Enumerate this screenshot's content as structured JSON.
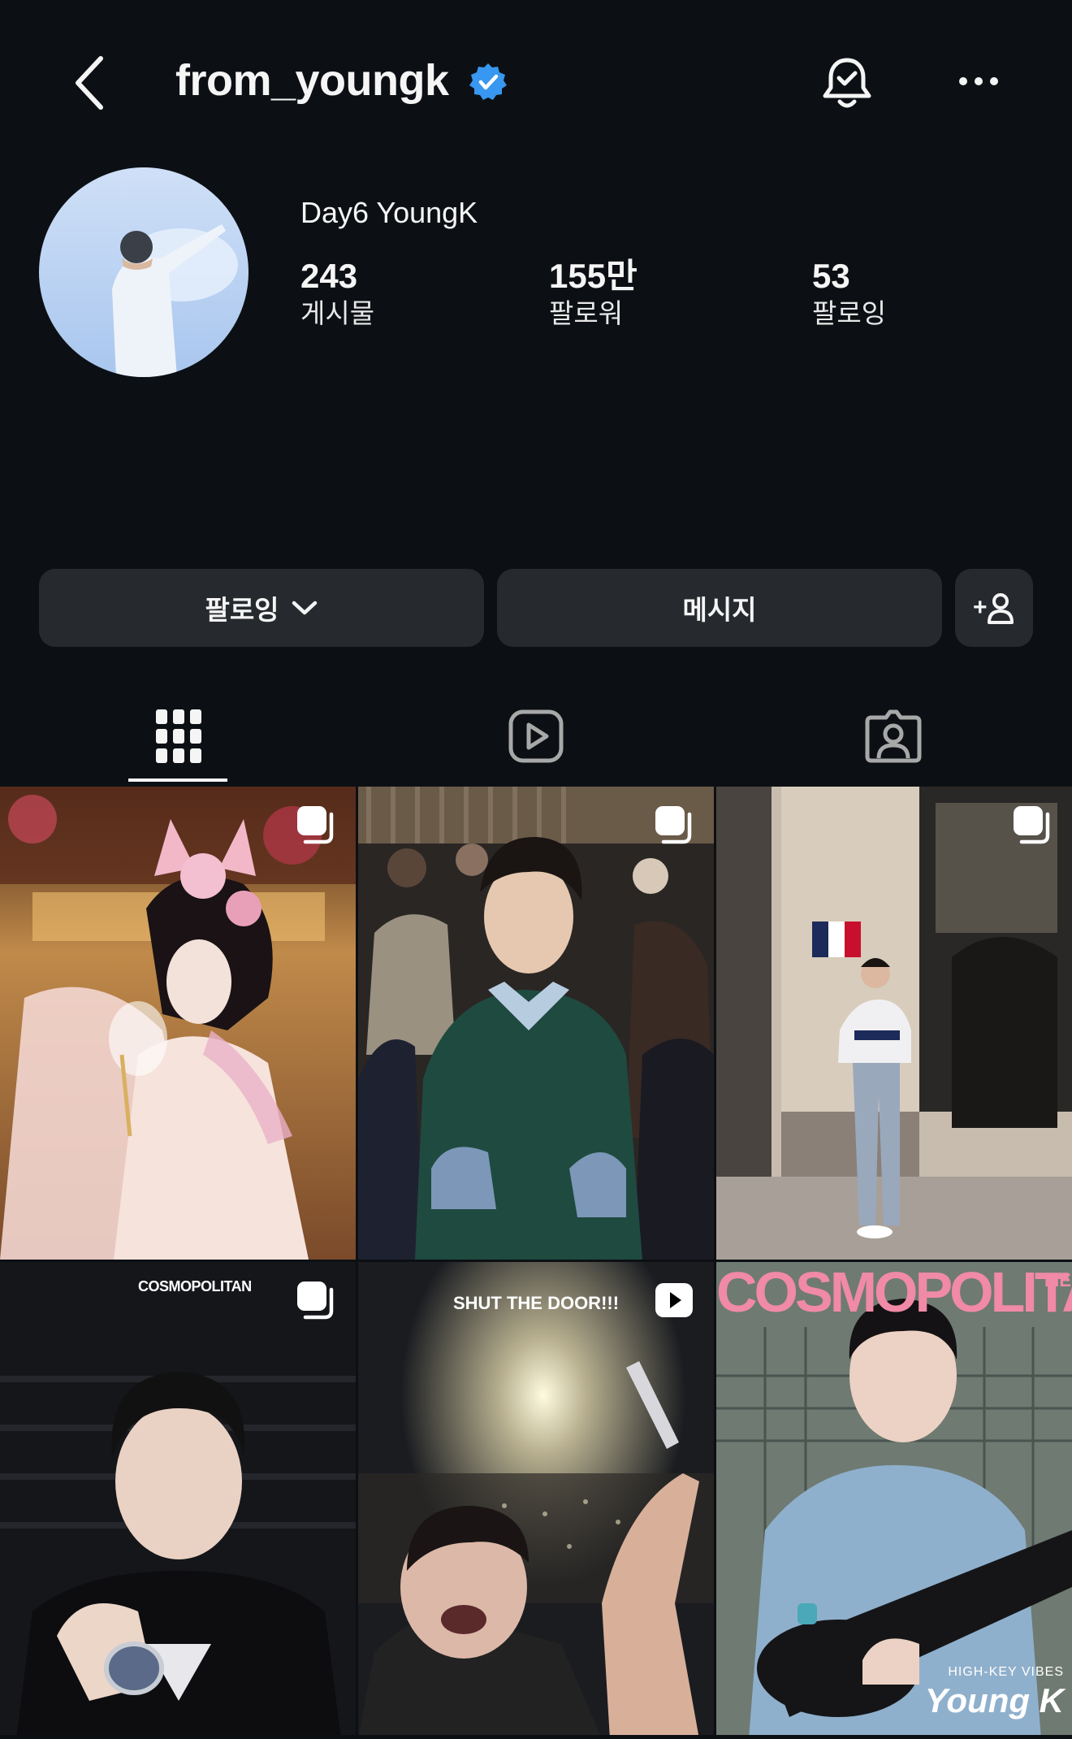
{
  "header": {
    "username": "from_youngk",
    "back_icon": "chevron-left-icon",
    "verified_icon": "verified-badge-icon",
    "bell_icon": "bell-check-icon",
    "more_icon": "more-horizontal-icon"
  },
  "profile": {
    "display_name": "Day6 YoungK",
    "stats": [
      {
        "number": "243",
        "label": "게시물"
      },
      {
        "number": "155만",
        "label": "팔로워"
      },
      {
        "number": "53",
        "label": "팔로잉"
      }
    ]
  },
  "actions": {
    "following_label": "팔로잉",
    "message_label": "메시지",
    "add_icon": "add-person-icon",
    "add_label": "+"
  },
  "tabs": [
    {
      "name": "grid",
      "icon": "grid-icon",
      "active": true
    },
    {
      "name": "reels",
      "icon": "reels-icon",
      "active": false
    },
    {
      "name": "tagged",
      "icon": "tagged-person-icon",
      "active": false
    }
  ],
  "posts": [
    {
      "badge": "carousel-icon",
      "overlay_text": ""
    },
    {
      "badge": "carousel-icon",
      "overlay_text": ""
    },
    {
      "badge": "carousel-icon",
      "overlay_text": ""
    },
    {
      "badge": "carousel-icon",
      "overlay_text": "COSMOPOLITAN"
    },
    {
      "badge": "reel-icon",
      "overlay_text": "SHUT THE DOOR!!!"
    },
    {
      "badge": "",
      "overlay_text": "COSMOPOLITAN",
      "overlay_sub": "MEN",
      "overlay_foot1": "HIGH-KEY VIBES",
      "overlay_foot2": "Young K"
    }
  ],
  "colors": {
    "background": "#0c1014",
    "button": "#262a2f",
    "verified": "#3897f0",
    "text": "#f5f5f5"
  }
}
